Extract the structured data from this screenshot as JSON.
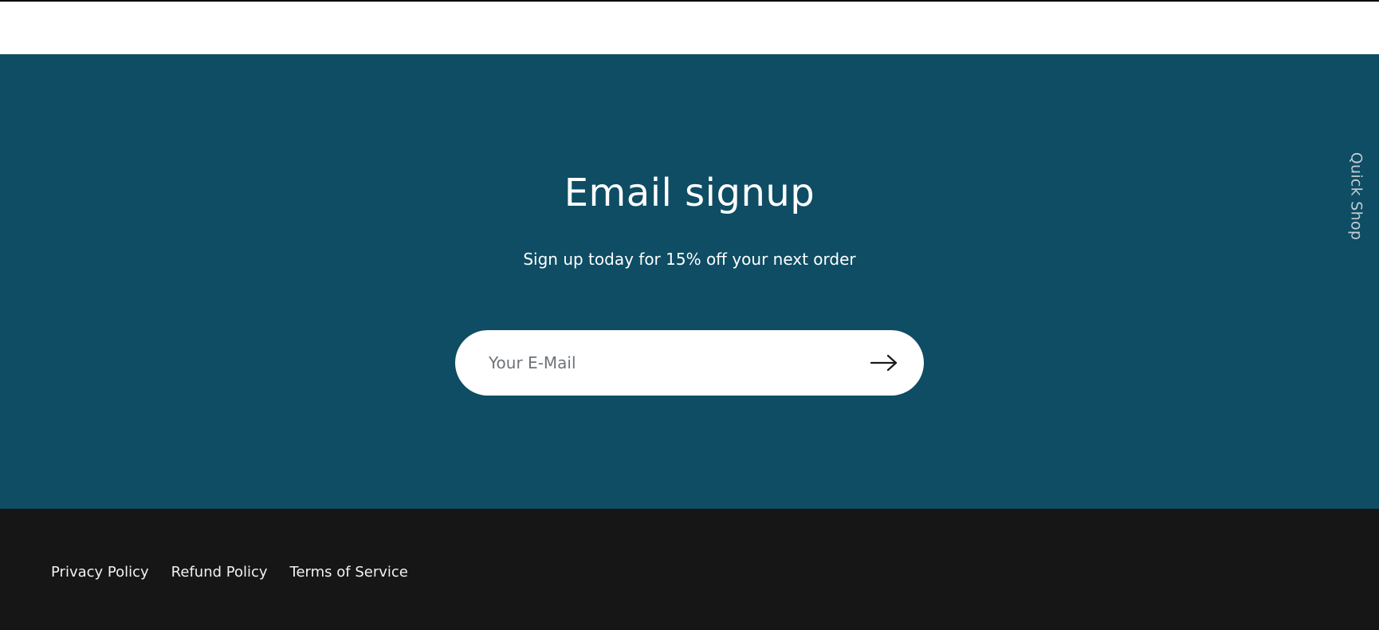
{
  "signup": {
    "title": "Email signup",
    "subtitle": "Sign up today for 15% off your next order",
    "email_placeholder": "Your E-Mail",
    "email_value": "",
    "submit_icon": "arrow-right-icon"
  },
  "quick_shop": {
    "label": "Quick Shop"
  },
  "footer": {
    "links": [
      {
        "label": "Privacy Policy"
      },
      {
        "label": "Refund Policy"
      },
      {
        "label": "Terms of Service"
      }
    ]
  },
  "colors": {
    "signup_background": "#0e4d64",
    "footer_background": "#161616",
    "text_light": "#ffffff",
    "placeholder": "#6e7378"
  }
}
